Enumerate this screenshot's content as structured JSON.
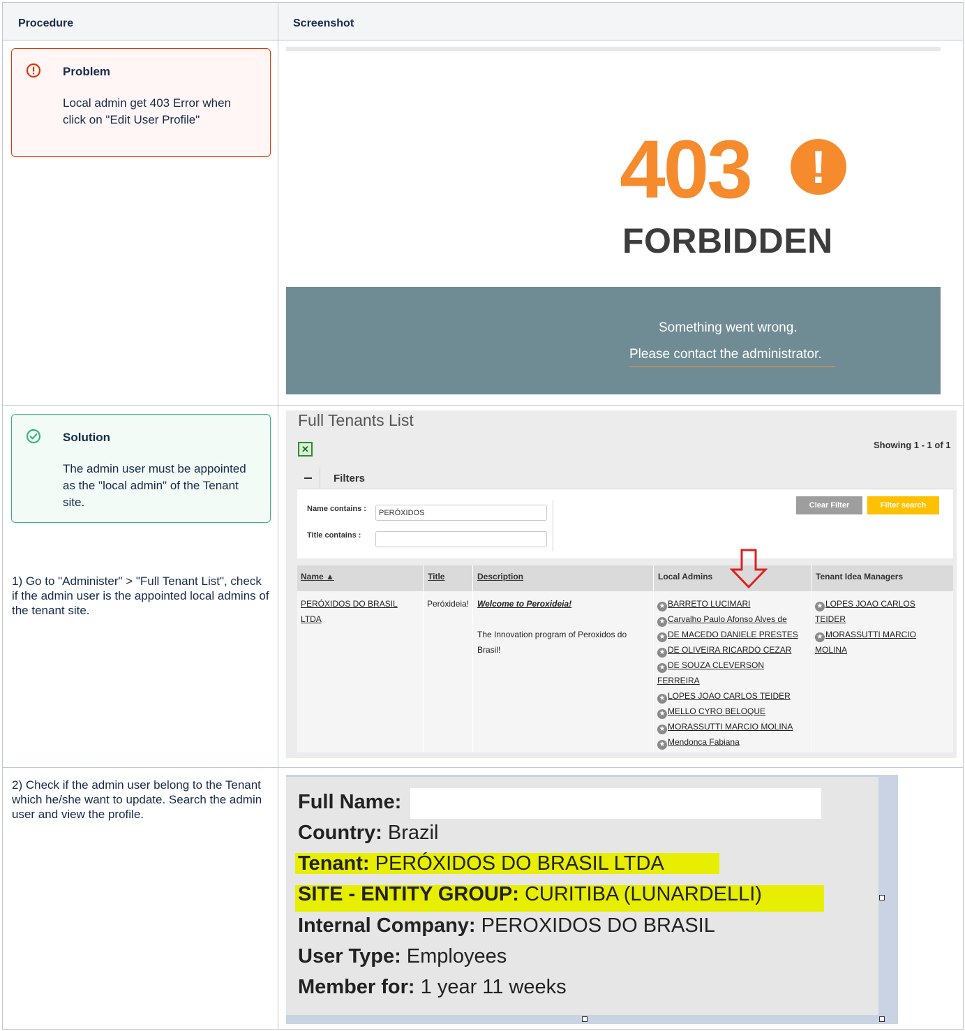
{
  "table": {
    "col_procedure": "Procedure",
    "col_screenshot": "Screenshot"
  },
  "problem": {
    "title": "Problem",
    "body": "Local admin get 403 Error when click on \"Edit User Profile\""
  },
  "solution": {
    "title": "Solution",
    "body": "The admin user must be appointed as the \"local admin\" of the Tenant site."
  },
  "steps": {
    "step1": "1) Go to \"Administer\" > \"Full Tenant List\", check if the admin user is the appointed local admins of the tenant site.",
    "step2": " 2) Check if the admin user belong to the Tenant which he/she want to update. Search the admin user and view the profile."
  },
  "error_page": {
    "code": "403",
    "alert_glyph": "!",
    "heading": "FORBIDDEN",
    "message": "Something went wrong.",
    "contact": "Please contact the administrator.",
    "accent_color": "#f68b2e",
    "band_color": "#6f8c95"
  },
  "tenants": {
    "title": "Full Tenants List",
    "showing": "Showing 1 - 1 of 1",
    "filters_label": "Filters",
    "name_label": "Name contains :",
    "name_value": "PERÓXIDOS",
    "title_label": "Title contains :",
    "title_value": "",
    "clear_button": "Clear Filter",
    "search_button": "Filter search",
    "columns": {
      "name": "Name ▲",
      "title": "Title",
      "description": "Description",
      "local_admins": "Local Admins",
      "idea_managers": "Tenant Idea Managers"
    },
    "row": {
      "name": "PERÓXIDOS DO BRASIL LTDA",
      "title": "Peróxideia!",
      "welcome": "Welcome to Peroxideia!",
      "description": "The Innovation program of Peroxidos do Brasil!",
      "local_admins": [
        "BARRETO LUCIMARI",
        "Carvalho Paulo Afonso Alves de",
        "DE MACEDO DANIELE PRESTES",
        "DE OLIVEIRA RICARDO CEZAR",
        "DE SOUZA CLEVERSON FERREIRA",
        "LOPES JOAO CARLOS TEIDER",
        "MELLO CYRO BELOQUE",
        "MORASSUTTI MARCIO MOLINA",
        "Mendonca Fabiana"
      ],
      "idea_managers": [
        "LOPES JOAO CARLOS TEIDER",
        "MORASSUTTI MARCIO MOLINA"
      ]
    }
  },
  "profile": {
    "full_name_label": "Full Name:",
    "full_name_value": "",
    "country_label": "Country:",
    "country_value": "Brazil",
    "tenant_label": "Tenant:",
    "tenant_value": "PERÓXIDOS DO BRASIL LTDA",
    "site_label": "SITE - ENTITY GROUP:",
    "site_value": "CURITIBA (LUNARDELLI)",
    "company_label": "Internal Company:",
    "company_value": "PEROXIDOS DO BRASIL",
    "usertype_label": "User Type:",
    "usertype_value": "Employees",
    "member_label": "Member for:",
    "member_value": "1 year 11 weeks",
    "highlight_color": "#e8ee00"
  }
}
